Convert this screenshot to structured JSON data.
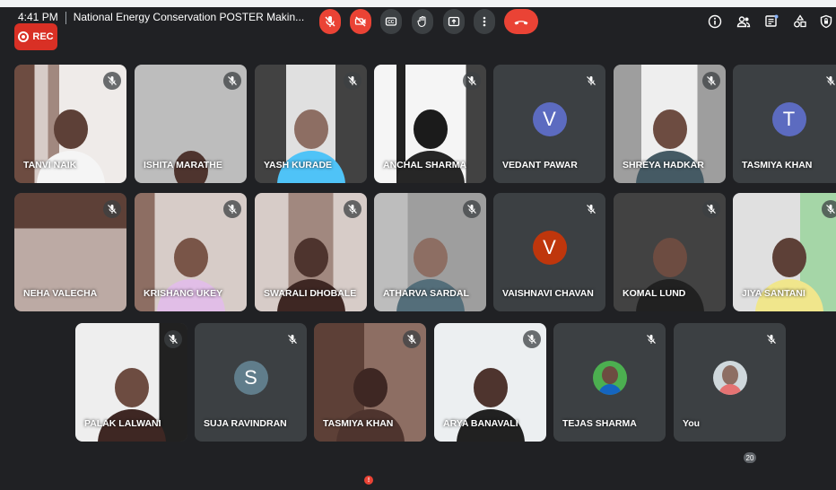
{
  "recording": {
    "label": "REC",
    "color": "#d93025"
  },
  "participants": [
    {
      "name": "TANVI NAIK",
      "type": "video"
    },
    {
      "name": "ISHITA MARATHE",
      "type": "video"
    },
    {
      "name": "YASH KURADE",
      "type": "video"
    },
    {
      "name": "ANCHAL SHARMA",
      "type": "video"
    },
    {
      "name": "VEDANT PAWAR",
      "type": "avatar",
      "initial": "V",
      "avatar_color": "#5c6bc0"
    },
    {
      "name": "SHREYA HADKAR",
      "type": "video"
    },
    {
      "name": "TASMIYA KHAN",
      "type": "avatar",
      "initial": "T",
      "avatar_color": "#5c6bc0"
    },
    {
      "name": "NEHA VALECHA",
      "type": "video"
    },
    {
      "name": "KRISHANG UKEY",
      "type": "video"
    },
    {
      "name": "SWARALI DHOBALE",
      "type": "video"
    },
    {
      "name": "ATHARVA SARDAL",
      "type": "video"
    },
    {
      "name": "VAISHNAVI CHAVAN",
      "type": "avatar",
      "initial": "V",
      "avatar_color": "#bf360c"
    },
    {
      "name": "KOMAL LUND",
      "type": "video"
    },
    {
      "name": "JIYA SANTANI",
      "type": "video"
    },
    {
      "name": "PALAK LALWANI",
      "type": "video"
    },
    {
      "name": "SUJA RAVINDRAN",
      "type": "avatar",
      "initial": "S",
      "avatar_color": "#607d8b"
    },
    {
      "name": "TASMIYA KHAN",
      "type": "video"
    },
    {
      "name": "ARYA BANAVALI",
      "type": "video"
    },
    {
      "name": "TEJAS SHARMA",
      "type": "photo"
    },
    {
      "name": "You",
      "type": "photo"
    }
  ],
  "bottom_bar": {
    "time": "4:41 PM",
    "meeting_title": "National Energy Conservation POSTER Makin...",
    "participant_count": "20",
    "camera_alert": "!",
    "end_call_color": "#ea4335"
  },
  "icons": {
    "mic_off": "mic-off-icon",
    "camera_off": "camera-off-icon",
    "captions": "captions-icon",
    "raise_hand": "raise-hand-icon",
    "present": "present-icon",
    "more": "more-options-icon",
    "end_call": "end-call-icon",
    "info": "info-icon",
    "people": "people-icon",
    "chat": "chat-icon",
    "activities": "activities-icon",
    "host_controls": "host-controls-icon"
  }
}
